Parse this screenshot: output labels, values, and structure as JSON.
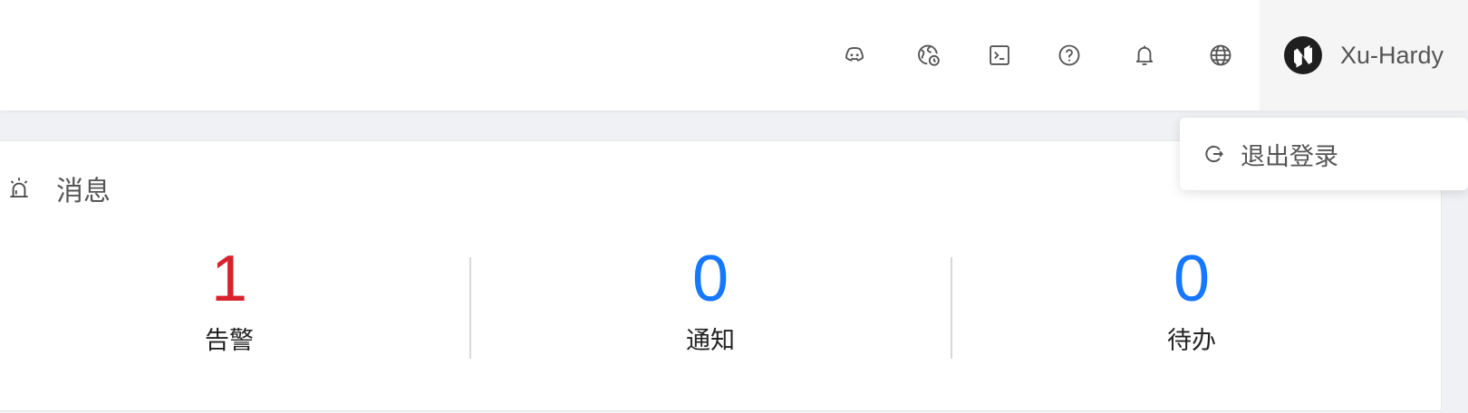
{
  "header": {
    "icons": [
      "discord-icon",
      "world-clock-icon",
      "terminal-icon",
      "help-icon",
      "bell-icon",
      "globe-icon"
    ],
    "user": {
      "name": "Xu-Hardy"
    }
  },
  "message_card": {
    "title": "消息",
    "stats": [
      {
        "value": "1",
        "label": "告警",
        "color": "#d9232c"
      },
      {
        "value": "0",
        "label": "通知",
        "color": "#1677ff"
      },
      {
        "value": "0",
        "label": "待办",
        "color": "#1677ff"
      }
    ]
  },
  "dropdown": {
    "logout_label": "退出登录"
  }
}
